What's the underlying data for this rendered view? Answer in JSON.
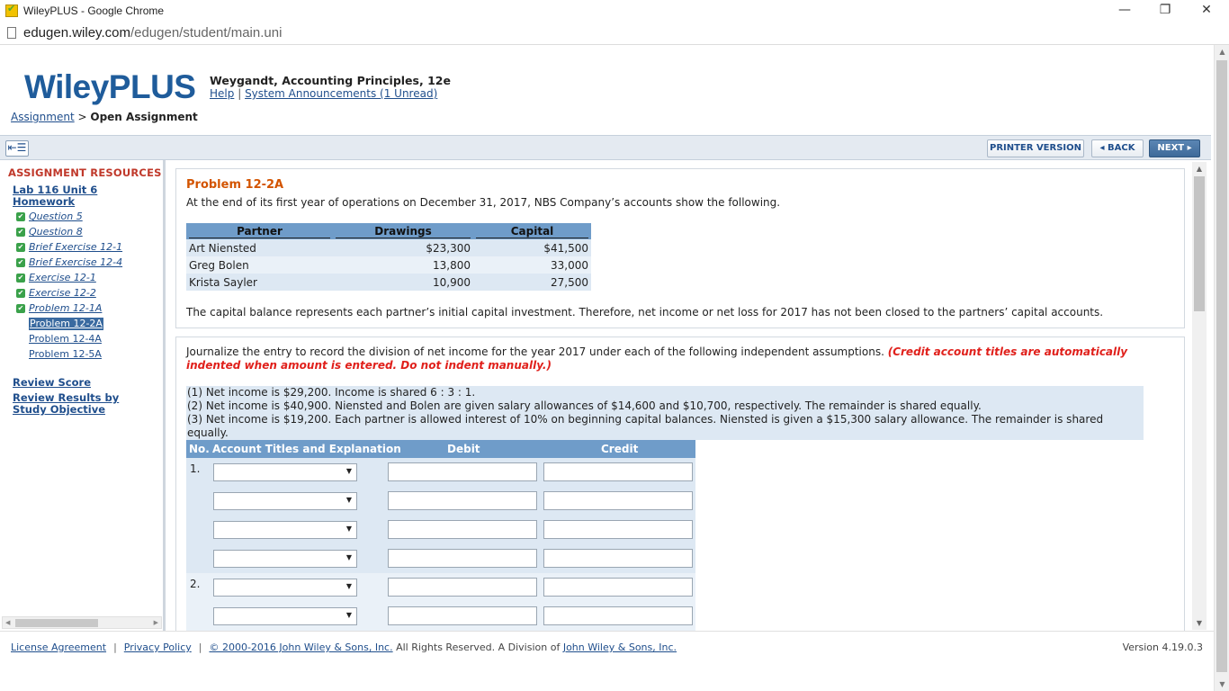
{
  "window": {
    "title": "WileyPLUS - Google Chrome",
    "url_host": "edugen.wiley.com",
    "url_path": "/edugen/student/main.uni",
    "minimize": "—",
    "restore": "❐",
    "close": "✕"
  },
  "header": {
    "logo": "WileyPLUS",
    "course_title": "Weygandt, Accounting Principles, 12e",
    "help_link": "Help",
    "separator": "|",
    "announcements_link": "System Announcements (1 Unread)"
  },
  "breadcrumb": {
    "parent": "Assignment",
    "sep": ">",
    "current": "Open Assignment"
  },
  "toolbar": {
    "printer_version": "PRINTER VERSION",
    "back": "◂ BACK",
    "next": "NEXT ▸"
  },
  "sidebar": {
    "resources_title": "ASSIGNMENT RESOURCES",
    "homework_line1": "Lab 116 Unit 6",
    "homework_line2": "Homework",
    "items": [
      {
        "label": "Question 5",
        "done": true
      },
      {
        "label": "Question 8",
        "done": true
      },
      {
        "label": "Brief Exercise 12-1",
        "done": true
      },
      {
        "label": "Brief Exercise 12-4",
        "done": true
      },
      {
        "label": "Exercise 12-1",
        "done": true
      },
      {
        "label": "Exercise 12-2",
        "done": true
      },
      {
        "label": "Problem 12-1A",
        "done": true
      },
      {
        "label": "Problem 12-2A",
        "done": false,
        "selected": true
      },
      {
        "label": "Problem 12-4A",
        "done": false
      },
      {
        "label": "Problem 12-5A",
        "done": false
      }
    ],
    "review_score": "Review Score",
    "review_results_line1": "Review Results by",
    "review_results_line2": "Study Objective"
  },
  "problem": {
    "title": "Problem 12-2A",
    "intro": "At the end of its first year of operations on December 31, 2017, NBS Company’s accounts show the following.",
    "table": {
      "headers": [
        "Partner",
        "Drawings",
        "Capital"
      ],
      "rows": [
        [
          "Art Niensted",
          "$23,300",
          "$41,500"
        ],
        [
          "Greg Bolen",
          "13,800",
          "33,000"
        ],
        [
          "Krista Sayler",
          "10,900",
          "27,500"
        ]
      ]
    },
    "capital_note": "The capital balance represents each partner’s initial capital investment. Therefore, net income or net loss for 2017 has not been closed to the partners’ capital accounts."
  },
  "instructions": {
    "text": "Journalize the entry to record the division of net income for the year 2017 under each of the following independent assumptions. ",
    "warning": "(Credit account titles are automatically indented when amount is entered. Do not indent manually.)",
    "assumptions": [
      "(1)  Net income is $29,200. Income is shared 6 : 3 : 1.",
      "(2)  Net income is $40,900. Niensted and Bolen are given salary allowances of $14,600 and $10,700, respectively. The remainder is shared equally.",
      "(3)  Net income is $19,200. Each partner is allowed interest of 10% on beginning capital balances. Niensted is given a $15,300 salary allowance. The remainder is shared equally."
    ]
  },
  "journal": {
    "headers": {
      "no": "No.",
      "account": "Account Titles and Explanation",
      "debit": "Debit",
      "credit": "Credit"
    },
    "entry_numbers": [
      "1.",
      "2."
    ]
  },
  "footer": {
    "license": "License Agreement",
    "privacy": "Privacy Policy",
    "copyright_link": "© 2000-2016 John Wiley & Sons, Inc.",
    "rights": " All Rights Reserved. A Division of ",
    "wiley_link": "John Wiley & Sons, Inc.",
    "pipe": "|",
    "version": "Version 4.19.0.3"
  }
}
